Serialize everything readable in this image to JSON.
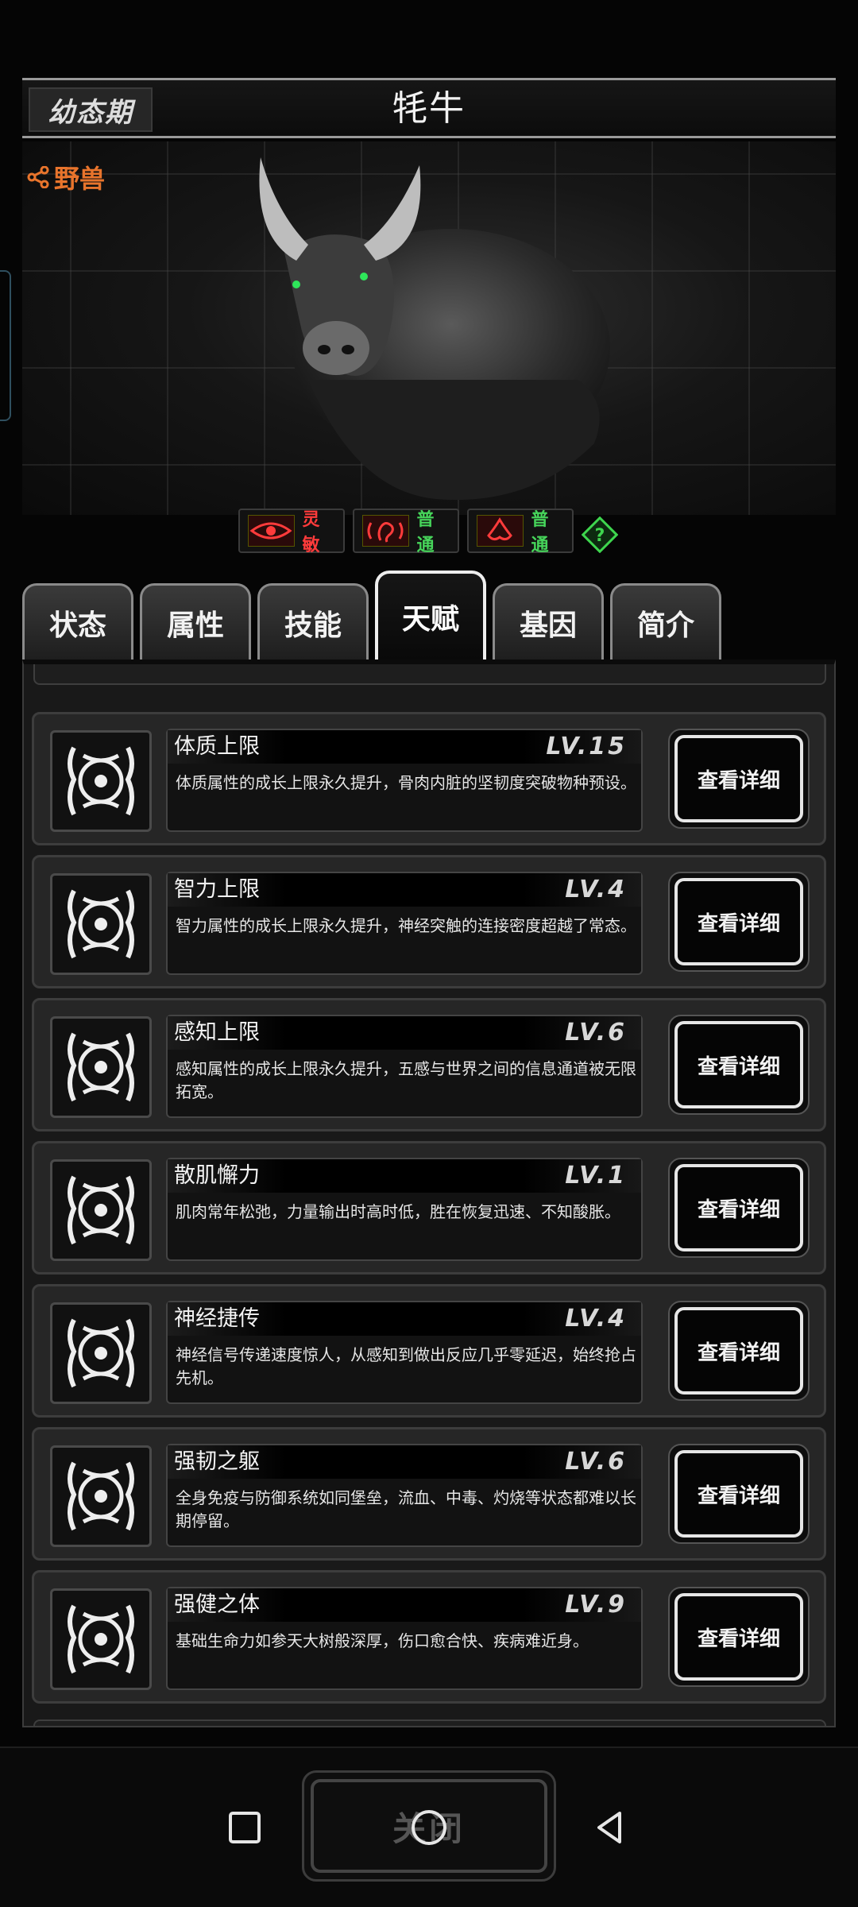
{
  "header": {
    "stage": "幼态期",
    "title": "牦牛",
    "tag": "野兽"
  },
  "senses": [
    {
      "label": "灵敏",
      "color": "#ff3b3b",
      "icon": "eye-icon"
    },
    {
      "label": "普通",
      "color": "#46d45a",
      "icon": "ear-icon"
    },
    {
      "label": "普通",
      "color": "#46d45a",
      "icon": "nose-icon"
    }
  ],
  "tabs": [
    {
      "label": "状态"
    },
    {
      "label": "属性"
    },
    {
      "label": "技能"
    },
    {
      "label": "天赋",
      "active": true
    },
    {
      "label": "基因"
    },
    {
      "label": "简介"
    }
  ],
  "talents": [
    {
      "name": "体质上限",
      "level": "LV.15",
      "desc": "体质属性的成长上限永久提升，骨肉内脏的坚韧度突破物种预设。",
      "button": "查看详细"
    },
    {
      "name": "智力上限",
      "level": "LV.4",
      "desc": "智力属性的成长上限永久提升，神经突触的连接密度超越了常态。",
      "button": "查看详细"
    },
    {
      "name": "感知上限",
      "level": "LV.6",
      "desc": "感知属性的成长上限永久提升，五感与世界之间的信息通道被无限拓宽。",
      "button": "查看详细"
    },
    {
      "name": "散肌懈力",
      "level": "LV.1",
      "desc": "肌肉常年松弛，力量输出时高时低，胜在恢复迅速、不知酸胀。",
      "button": "查看详细"
    },
    {
      "name": "神经捷传",
      "level": "LV.4",
      "desc": "神经信号传递速度惊人，从感知到做出反应几乎零延迟，始终抢占先机。",
      "button": "查看详细"
    },
    {
      "name": "强韧之躯",
      "level": "LV.6",
      "desc": "全身免疫与防御系统如同堡垒，流血、中毒、灼烧等状态都难以长期停留。",
      "button": "查看详细"
    },
    {
      "name": "强健之体",
      "level": "LV.9",
      "desc": "基础生命力如参天大树般深厚，伤口愈合快、疾病难近身。",
      "button": "查看详细"
    }
  ],
  "footer": {
    "close_label": "关闭"
  }
}
